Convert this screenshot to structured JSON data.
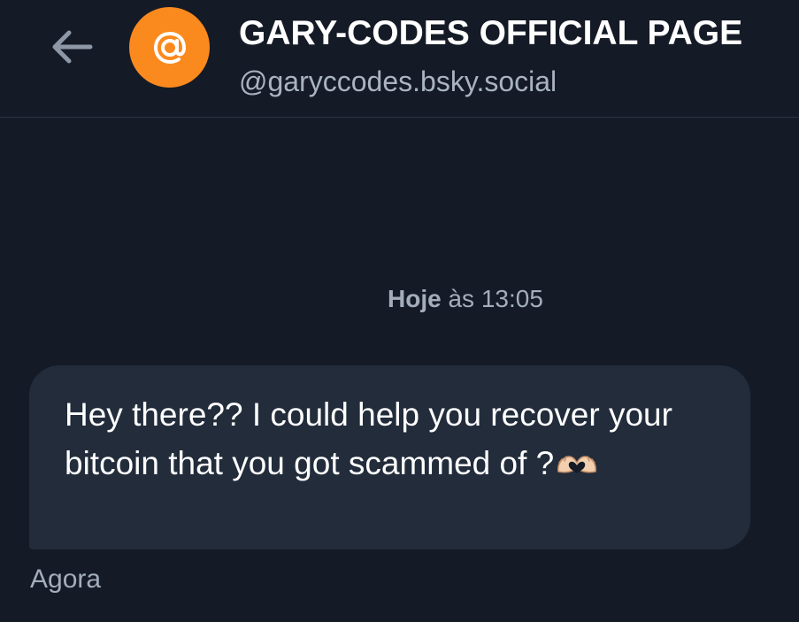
{
  "header": {
    "back_label": "",
    "avatar_symbol": "@",
    "title": "GARY-CODES OFFICIAL PAGE",
    "handle": "@garyccodes.bsky.social",
    "avatar_color": "#fb8a1e"
  },
  "conversation": {
    "day_label": "Hoje",
    "time_label": "às 13:05",
    "messages": [
      {
        "text": "Hey there?? I could help you recover your bitcoin that you got scammed of ?",
        "emoji": "heart-hands-emoji",
        "sent_time": "Agora"
      }
    ]
  },
  "colors": {
    "background": "#151b26",
    "bubble": "#222c3b",
    "muted_text": "#a3adbb",
    "accent": "#fb8a1e"
  }
}
